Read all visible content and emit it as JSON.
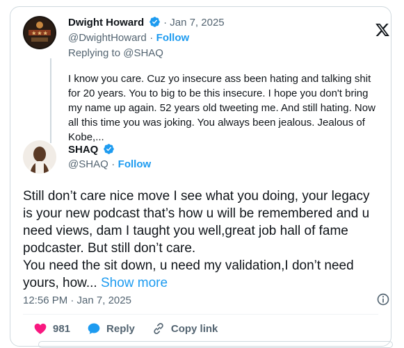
{
  "reply_tweet": {
    "author_name": "Dwight Howard",
    "separator_date": "· Jan 7, 2025",
    "handle": "@DwightHoward",
    "follow_label": "Follow",
    "replying_to": "Replying to @SHAQ",
    "text": "I know you care. Cuz yo insecure ass been hating and talking shit\nfor 20 years. You to big to be this insecure.  I hope you don't bring\nmy name up again.  52 years old tweeting me.  And still hating. Now\nall this time you was joking.  You always been jealous.  Jealous of\nKobe,..."
  },
  "main_tweet": {
    "author_name": "SHAQ",
    "handle": "@SHAQ",
    "follow_label": "Follow",
    "text": "Still don’t care nice move I see what you doing, your legacy\nis your new podcast that’s how u will be remembered and u\nneed views, dam I taught you well,great job hall of fame\npodcaster. But still don’t care.\nYou need the sit down, u need my validation,I don’t need\nyours, how... ",
    "show_more_label": "Show more",
    "timestamp": "12:56 PM · Jan 7, 2025",
    "like_count": "981",
    "reply_label": "Reply",
    "copy_link_label": "Copy link"
  },
  "icons": {
    "logo": "x-logo-icon",
    "verified": "verified-badge-icon",
    "info": "info-icon",
    "like": "heart-icon",
    "reply": "reply-bubble-icon",
    "copy": "link-icon"
  },
  "colors": {
    "accent": "#1d9bf0",
    "like": "#f91880",
    "text": "#0f1419",
    "muted": "#536471",
    "border": "#cfd9de"
  }
}
